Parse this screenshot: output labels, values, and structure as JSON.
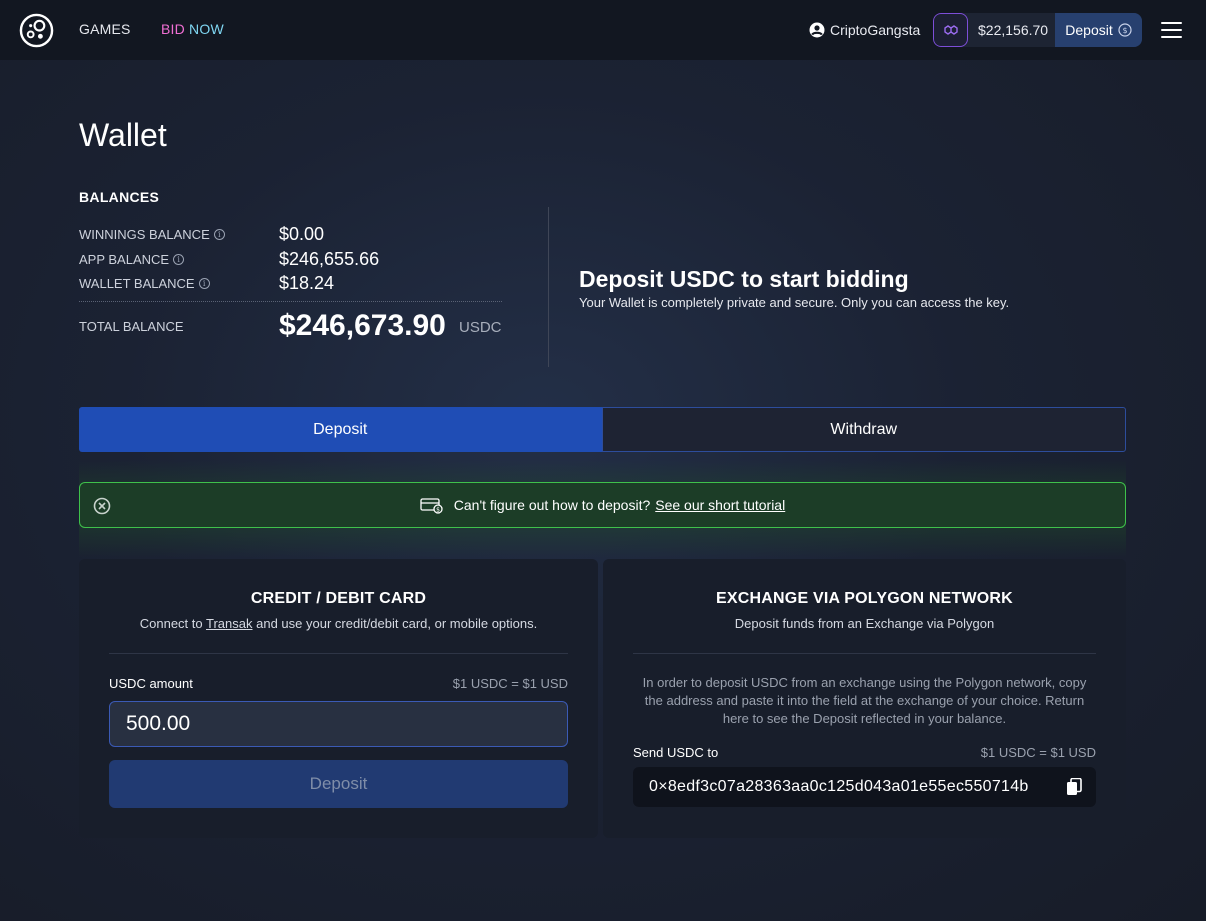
{
  "nav": {
    "games": "GAMES",
    "bid_part1": "BID",
    "bid_part2": "NOW",
    "username": "CriptoGangsta",
    "balance": "$22,156.70",
    "deposit": "Deposit"
  },
  "wallet": {
    "title": "Wallet",
    "balances_heading": "BALANCES",
    "rows": [
      {
        "label": "WINNINGS BALANCE",
        "value": "$0.00"
      },
      {
        "label": "APP BALANCE",
        "value": "$246,655.66"
      },
      {
        "label": "WALLET BALANCE",
        "value": "$18.24"
      }
    ],
    "total_label": "TOTAL BALANCE",
    "total_value": "$246,673.90",
    "total_unit": "USDC"
  },
  "promo": {
    "title": "Deposit USDC to start bidding",
    "subtitle": "Your Wallet is completely private and secure. Only you can access the key."
  },
  "tabs": {
    "deposit": "Deposit",
    "withdraw": "Withdraw"
  },
  "tutorial": {
    "text": "Can't figure out how to deposit?",
    "link": "See our short tutorial"
  },
  "card_panel": {
    "title": "CREDIT / DEBIT CARD",
    "sub_before": "Connect to",
    "sub_link": "Transak",
    "sub_after": "and use your credit/debit card, or mobile options.",
    "amount_label": "USDC amount",
    "rate": "$1 USDC = $1 USD",
    "amount_value": "500.00",
    "button": "Deposit"
  },
  "exchange_panel": {
    "title": "EXCHANGE VIA POLYGON NETWORK",
    "subtitle": "Deposit funds from an Exchange via Polygon",
    "instructions": "In order to deposit USDC from an exchange using the Polygon network, copy the address and paste it into the field at the exchange of your choice. Return here to see the Deposit reflected in your balance.",
    "send_label": "Send USDC to",
    "rate": "$1 USDC = $1 USD",
    "address": "0×8edf3c07a28363aa0c125d043a01e55ec550714b"
  },
  "colors": {
    "accent_blue": "#1f4db5",
    "success_green": "#3fc14b",
    "bid_pink": "#f06fd4",
    "bid_cyan": "#7fd6f2",
    "chain_purple": "#7d4ed8"
  },
  "icons": [
    "logo-icon",
    "user-icon",
    "polygon-chain-icon",
    "usdc-coin-icon",
    "menu-icon",
    "info-icon",
    "close-circle-icon",
    "money-card-icon",
    "copy-icon"
  ]
}
